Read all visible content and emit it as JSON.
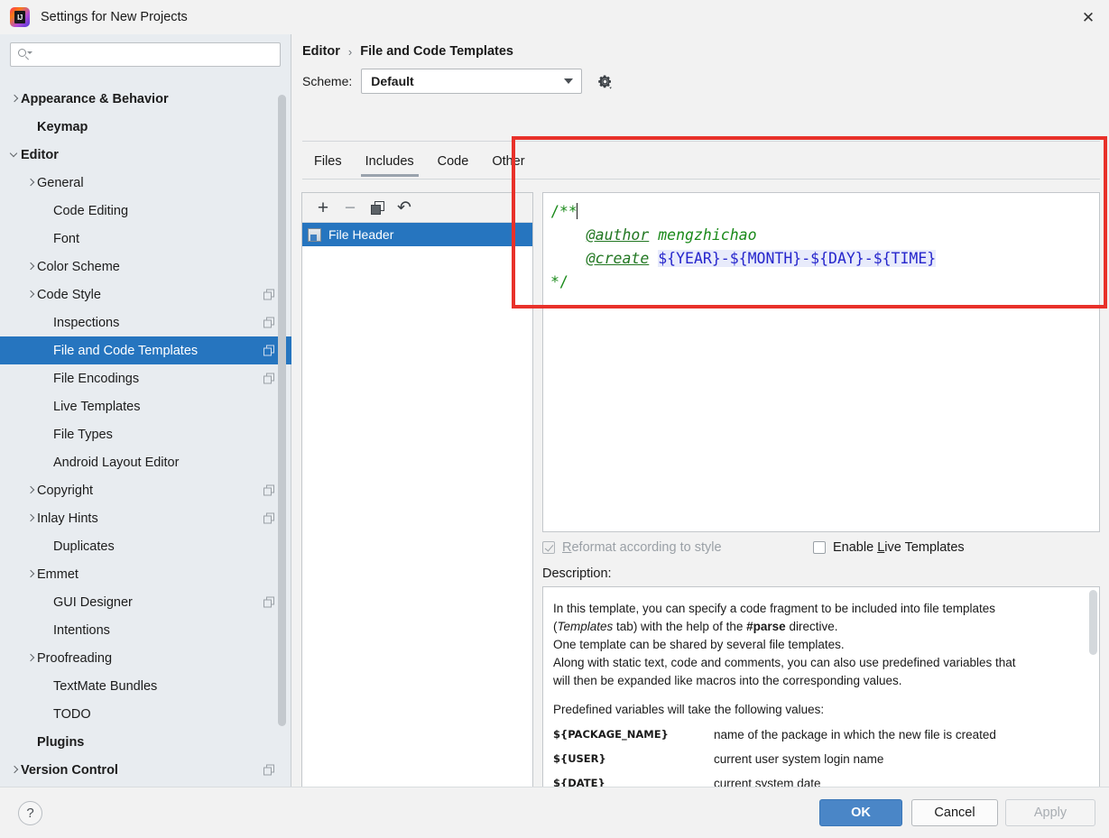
{
  "window": {
    "title": "Settings for New Projects",
    "logo_icon": "intellij-idea-logo",
    "close_icon": "close-icon",
    "close_glyph": "✕"
  },
  "search": {
    "placeholder": "",
    "value": "",
    "icon": "search-icon"
  },
  "sidebar": {
    "items": [
      {
        "label": "Appearance & Behavior",
        "indent": 0,
        "chevron": "right",
        "bold": true,
        "selected": false,
        "badge": false
      },
      {
        "label": "Keymap",
        "indent": 1,
        "chevron": "none",
        "bold": true,
        "selected": false,
        "badge": false
      },
      {
        "label": "Editor",
        "indent": 0,
        "chevron": "down",
        "bold": true,
        "selected": false,
        "badge": false
      },
      {
        "label": "General",
        "indent": 1,
        "chevron": "right",
        "bold": false,
        "selected": false,
        "badge": false
      },
      {
        "label": "Code Editing",
        "indent": 2,
        "chevron": "none",
        "bold": false,
        "selected": false,
        "badge": false
      },
      {
        "label": "Font",
        "indent": 2,
        "chevron": "none",
        "bold": false,
        "selected": false,
        "badge": false
      },
      {
        "label": "Color Scheme",
        "indent": 1,
        "chevron": "right",
        "bold": false,
        "selected": false,
        "badge": false
      },
      {
        "label": "Code Style",
        "indent": 1,
        "chevron": "right",
        "bold": false,
        "selected": false,
        "badge": true
      },
      {
        "label": "Inspections",
        "indent": 2,
        "chevron": "none",
        "bold": false,
        "selected": false,
        "badge": true
      },
      {
        "label": "File and Code Templates",
        "indent": 2,
        "chevron": "none",
        "bold": false,
        "selected": true,
        "badge": true
      },
      {
        "label": "File Encodings",
        "indent": 2,
        "chevron": "none",
        "bold": false,
        "selected": false,
        "badge": true
      },
      {
        "label": "Live Templates",
        "indent": 2,
        "chevron": "none",
        "bold": false,
        "selected": false,
        "badge": false
      },
      {
        "label": "File Types",
        "indent": 2,
        "chevron": "none",
        "bold": false,
        "selected": false,
        "badge": false
      },
      {
        "label": "Android Layout Editor",
        "indent": 2,
        "chevron": "none",
        "bold": false,
        "selected": false,
        "badge": false
      },
      {
        "label": "Copyright",
        "indent": 1,
        "chevron": "right",
        "bold": false,
        "selected": false,
        "badge": true
      },
      {
        "label": "Inlay Hints",
        "indent": 1,
        "chevron": "right",
        "bold": false,
        "selected": false,
        "badge": true
      },
      {
        "label": "Duplicates",
        "indent": 2,
        "chevron": "none",
        "bold": false,
        "selected": false,
        "badge": false
      },
      {
        "label": "Emmet",
        "indent": 1,
        "chevron": "right",
        "bold": false,
        "selected": false,
        "badge": false
      },
      {
        "label": "GUI Designer",
        "indent": 2,
        "chevron": "none",
        "bold": false,
        "selected": false,
        "badge": true
      },
      {
        "label": "Intentions",
        "indent": 2,
        "chevron": "none",
        "bold": false,
        "selected": false,
        "badge": false
      },
      {
        "label": "Proofreading",
        "indent": 1,
        "chevron": "right",
        "bold": false,
        "selected": false,
        "badge": false
      },
      {
        "label": "TextMate Bundles",
        "indent": 2,
        "chevron": "none",
        "bold": false,
        "selected": false,
        "badge": false
      },
      {
        "label": "TODO",
        "indent": 2,
        "chevron": "none",
        "bold": false,
        "selected": false,
        "badge": false
      },
      {
        "label": "Plugins",
        "indent": 1,
        "chevron": "none",
        "bold": true,
        "selected": false,
        "badge": false
      },
      {
        "label": "Version Control",
        "indent": 0,
        "chevron": "right",
        "bold": true,
        "selected": false,
        "badge": true
      }
    ]
  },
  "breadcrumb": {
    "parent": "Editor",
    "separator": "›",
    "current": "File and Code Templates"
  },
  "scheme": {
    "label": "Scheme:",
    "value": "Default",
    "gear_icon": "gear-icon",
    "dropdown_icon": "chevron-down-icon"
  },
  "tabs": [
    {
      "label": "Files",
      "active": false
    },
    {
      "label": "Includes",
      "active": true
    },
    {
      "label": "Code",
      "active": false
    },
    {
      "label": "Other",
      "active": false
    }
  ],
  "list_toolbar": {
    "add_icon": "plus-icon",
    "add_glyph": "+",
    "remove_icon": "minus-icon",
    "remove_glyph": "−",
    "copy_icon": "copy-icon",
    "revert_icon": "revert-arrow-icon",
    "revert_glyph": "↶"
  },
  "template_list": [
    {
      "label": "File Header",
      "selected": true,
      "icon": "template-file-icon"
    }
  ],
  "editor": {
    "lines": [
      {
        "type": "comment",
        "text": "/**"
      },
      {
        "type": "mixed",
        "indent": "    ",
        "tag": "@author",
        "rest": " mengzhichao"
      },
      {
        "type": "mixed_vars",
        "indent": "    ",
        "tag": "@create",
        "vars": [
          "${YEAR}",
          "${MONTH}",
          "${DAY}",
          "${TIME}"
        ],
        "sep": "-"
      },
      {
        "type": "comment",
        "text": "*/"
      }
    ],
    "full_text": "/**\n    @author mengzhichao\n    @create ${YEAR}-${MONTH}-${DAY}-${TIME}\n*/"
  },
  "options": {
    "reformat": {
      "label": "Reformat according to style",
      "mnemonic": "R",
      "checked": true,
      "enabled": false
    },
    "live_templates": {
      "label": "Enable Live Templates",
      "mnemonic": "L",
      "checked": false,
      "enabled": true
    }
  },
  "description": {
    "label": "Description:",
    "paragraphs": [
      "In this template, you can specify a code fragment to be included into file templates",
      "(Templates tab) with the help of the #parse directive.",
      "One template can be shared by several file templates.",
      "Along with static text, code and comments, you can also use predefined variables that",
      "will then be expanded like macros into the corresponding values."
    ],
    "line2_italic": "Templates",
    "line2_pre": "(",
    "line2_mid": " tab) with the help of the ",
    "line2_bold": "#parse",
    "line2_post": " directive.",
    "variables_intro": "Predefined variables will take the following values:",
    "variables": [
      {
        "name": "${PACKAGE_NAME}",
        "desc": "name of the package in which the new file is created"
      },
      {
        "name": "${USER}",
        "desc": "current user system login name"
      },
      {
        "name": "${DATE}",
        "desc": "current system date"
      }
    ]
  },
  "footer": {
    "help_icon": "help-icon",
    "help_glyph": "?",
    "ok": "OK",
    "cancel": "Cancel",
    "apply": "Apply"
  },
  "colors": {
    "accent_blue": "#2675bf",
    "primary_button": "#4a86c7",
    "annotation_red": "#e8312a",
    "code_green": "#1a8a1a",
    "code_variable_blue": "#2525cc"
  }
}
